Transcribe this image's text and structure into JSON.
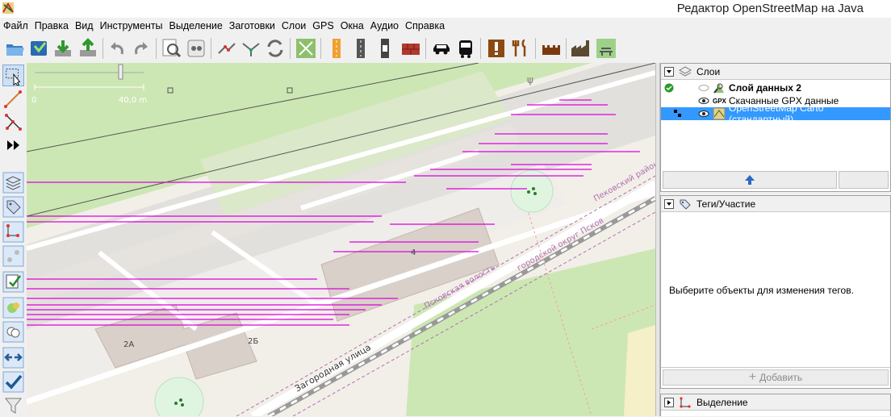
{
  "window": {
    "title": "Редактор OpenStreetMap на Java"
  },
  "menu": [
    "Файл",
    "Правка",
    "Вид",
    "Инструменты",
    "Выделение",
    "Заготовки",
    "Слои",
    "GPS",
    "Окна",
    "Аудио",
    "Справка"
  ],
  "toolbar": {
    "icons": [
      "open-file-icon",
      "save-icon",
      "download-icon",
      "upload-icon",
      "undo-icon",
      "redo-icon",
      "zoom-icon",
      "preferences-icon",
      "split-way-icon",
      "combine-way-icon",
      "reverse-way-icon",
      "align-circle-icon",
      "highway-preset-icon",
      "track-preset-icon",
      "railway-preset-icon",
      "barrier-wall-preset-icon",
      "car-icon",
      "bus-icon",
      "warning-preset-icon",
      "restaurant-icon",
      "castle-icon",
      "industrial-icon",
      "bench-icon"
    ]
  },
  "left_tools": [
    "select-tool-icon",
    "draw-tool-icon",
    "improve-way-tool-icon",
    "more-tools-icon",
    "layers-toggle-icon",
    "tags-toggle-icon",
    "selection-toggle-icon",
    "relations-toggle-icon",
    "validator-toggle-icon",
    "filter-toggle-icon",
    "conflict-toggle-icon",
    "changeset-toggle-icon",
    "check-toggle-icon",
    "funnel-toggle-icon"
  ],
  "map": {
    "scale_start": "0",
    "scale_end": "40,0 m",
    "labels": {
      "street": "Загородная улица",
      "boundary1": "Пековский район",
      "boundary2": "Псковская волость",
      "boundary3": "городской округ Псков",
      "house_2a": "2А",
      "house_2b": "2Б",
      "house_4": "4"
    },
    "colors": {
      "gps_track": "#dd00dd",
      "boundary": "#b070b0"
    }
  },
  "layers_panel": {
    "title": "Слои",
    "rows": [
      {
        "name": "Слой данных 2",
        "bold": true
      },
      {
        "prefix": "GPX",
        "name": "Скачанные GPX данные"
      },
      {
        "name": "OpenStreetMap Carto (стандартный)",
        "selected": true
      }
    ]
  },
  "tags_panel": {
    "title": "Теги/Участие",
    "empty_message": "Выберите объекты для изменения тегов.",
    "add_label": "Добавить"
  },
  "selection_panel": {
    "title": "Выделение"
  }
}
